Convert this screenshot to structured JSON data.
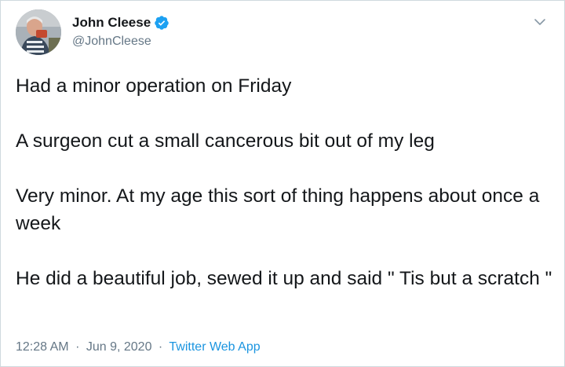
{
  "tweet": {
    "author": {
      "display_name": "John Cleese",
      "handle": "@JohnCleese",
      "verified": true,
      "verified_color": "#1da1f2"
    },
    "paragraphs": [
      "Had a minor operation on Friday",
      "A surgeon cut a small cancerous bit out of my leg",
      "Very minor. At my age this sort of thing happens about once a week",
      "He did a beautiful job, sewed it up and said \" Tis but a scratch \""
    ],
    "time": "12:28 AM",
    "separator": "·",
    "date": "Jun 9, 2020",
    "source": "Twitter Web App",
    "link_color": "#1b95e0",
    "icons": {
      "verified": "verified-badge-icon",
      "menu": "chevron-down-icon"
    }
  }
}
